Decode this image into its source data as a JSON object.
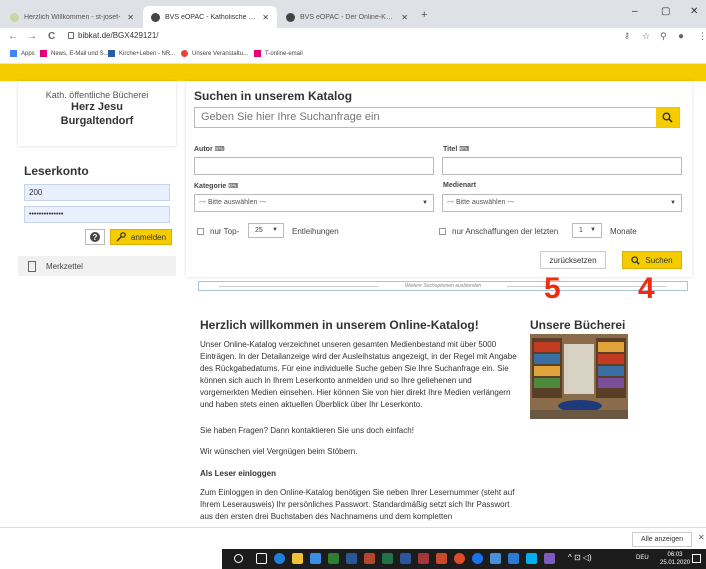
{
  "browser": {
    "tabs": [
      {
        "title": "Herzlich Willkommen - st-josef-",
        "active": false
      },
      {
        "title": "BVS eOPAC - Katholische öffentl",
        "active": true
      },
      {
        "title": "BVS eOPAC - Der Online-Katalog",
        "active": false
      }
    ],
    "new_tab": "+",
    "minimize": "–",
    "maximize": "▢",
    "close": "✕",
    "url": "bibkat.de/BGX429121/",
    "back": "←",
    "forward": "→",
    "reload": "C"
  },
  "bookmarks": [
    {
      "label": "Apps",
      "icon": "apps-grid-icon",
      "color": "#4285f4"
    },
    {
      "label": "News, E-Mail und S...",
      "icon": "t-online-icon",
      "color": "#e20074"
    },
    {
      "label": "Kirche+Leben - NR...",
      "icon": "kirche-leben-icon",
      "color": "#2a5caa"
    },
    {
      "label": "Unsere Veranstaltu...",
      "icon": "google-icon",
      "color": "#ea4335"
    },
    {
      "label": "T-online-email",
      "icon": "t-online-icon",
      "color": "#e20074"
    }
  ],
  "library": {
    "prefix": "Kath. öffentliche Bücherei",
    "name_line1": "Herz Jesu",
    "name_line2": "Burgaltendorf"
  },
  "account": {
    "title": "Leserkonto",
    "reader_number": "200",
    "password_masked": "••••••••••••••",
    "login_label": "anmelden",
    "help_label": "?",
    "notepad_label": "Merkzettel"
  },
  "search": {
    "title": "Suchen in unserem Katalog",
    "placeholder": "Geben Sie hier Ihre Suchanfrage ein",
    "author_label": "Autor",
    "title_label": "Titel",
    "category_label": "Kategorie",
    "media_label": "Medienart",
    "category_value": "--- Bitte auswählen ---",
    "media_value": "--- Bitte auswählen ---",
    "top_prefix": "nur Top-",
    "top_value": "25",
    "top_suffix": "Entleihungen",
    "recent_prefix": "nur Anschaffungen der letzten",
    "recent_value": "1",
    "recent_suffix": "Monate",
    "reset_label": "zurücksetzen",
    "search_label": "Suchen",
    "hide_options": "Weitere Suchoptionen ausblenden"
  },
  "annotations": {
    "reset_marker": "5",
    "search_marker": "4",
    "color": "#f02b12"
  },
  "welcome": {
    "title": "Herzlich willkommen in unserem Online-Katalog!",
    "para1": "Unser Online-Katalog verzeichnet unseren gesamten Medienbestand mit über 5000 Einträgen. In der Detailanzeige wird der Ausleihstatus angezeigt, in der Regel mit Angabe des Rückgabedatums. Für eine individuelle Suche geben Sie Ihre Suchanfrage ein. Sie können sich auch in Ihrem Leserkonto anmelden und so Ihre geliehenen und vorgemerkten Medien einsehen. Hier können Sie von hier direkt Ihre Medien verlängern und haben stets einen aktuellen Überblick über Ihr Leserkonto.",
    "para2": "Sie haben Fragen? Dann kontaktieren Sie uns doch einfach!",
    "para3": "Wir wünschen viel Vergnügen beim Stöbern.",
    "sub_heading": "Als Leser einloggen",
    "para4": "Zum Einloggen in den Online-Katalog benötigen Sie neben Ihrer Lesernummer (steht auf Ihrem Leserausweis) Ihr persönliches Passwort. Standardmäßig setzt sich Ihr Passwort aus den ersten drei Buchstaben des Nachnamens und dem kompletten",
    "library_title": "Unsere Bücherei"
  },
  "download_bar": {
    "show_all": "Alle anzeigen",
    "close": "✕"
  },
  "taskbar": {
    "lang": "DEU",
    "time": "06:03",
    "date": "25.01.2020"
  },
  "colors": {
    "accent": "#f5cc00",
    "input_fill": "#e8f0fe"
  }
}
